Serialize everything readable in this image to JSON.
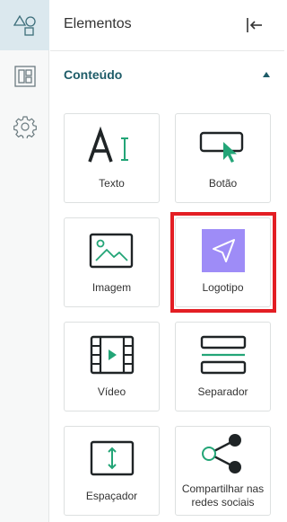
{
  "rail": {
    "items": [
      {
        "name": "elements",
        "icon": "shapes-icon",
        "active": true
      },
      {
        "name": "layout",
        "icon": "layout-icon",
        "active": false
      },
      {
        "name": "settings",
        "icon": "gear-icon",
        "active": false
      }
    ]
  },
  "panel": {
    "title": "Elementos",
    "collapse_icon": "collapse-left-icon"
  },
  "section": {
    "title": "Conteúdo",
    "expanded": true
  },
  "cards": [
    {
      "label": "Texto",
      "icon": "text-icon"
    },
    {
      "label": "Botão",
      "icon": "button-icon"
    },
    {
      "label": "Imagem",
      "icon": "image-icon"
    },
    {
      "label": "Logotipo",
      "icon": "logo-icon"
    },
    {
      "label": "Vídeo",
      "icon": "video-icon"
    },
    {
      "label": "Separador",
      "icon": "separator-icon"
    },
    {
      "label": "Espaçador",
      "icon": "spacer-icon"
    },
    {
      "label": "Compartilhar nas redes sociais",
      "icon": "share-icon"
    }
  ],
  "colors": {
    "accent": "#23a577",
    "dark": "#1f2426",
    "section_title": "#1e5c68",
    "logo_bg": "#9e8cf7",
    "highlight": "#e31e24"
  }
}
